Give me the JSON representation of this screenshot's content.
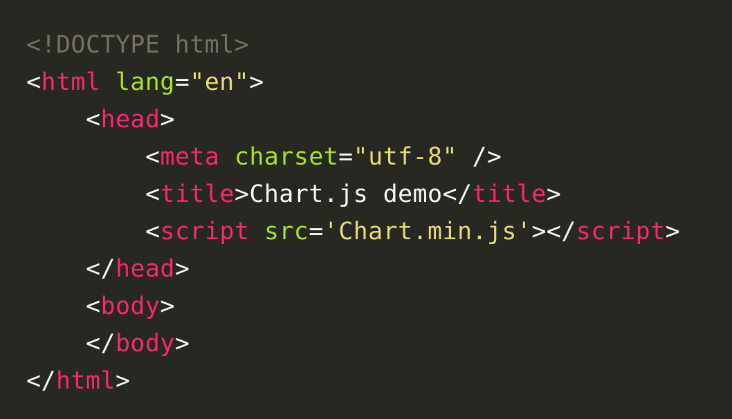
{
  "code": {
    "doctype": "<!DOCTYPE html>",
    "tags": {
      "html": "html",
      "head": "head",
      "meta": "meta",
      "title": "title",
      "script": "script",
      "body": "body"
    },
    "attrs": {
      "lang": "lang",
      "charset": "charset",
      "src": "src"
    },
    "values": {
      "lang": "\"en\"",
      "charset": "\"utf-8\"",
      "src": "'Chart.min.js'"
    },
    "title_text": "Chart.js demo"
  },
  "colors": {
    "background": "#272822",
    "tag": "#f92672",
    "attribute": "#a6e22e",
    "string": "#e6db74",
    "doctype": "#75715e",
    "text": "#f8f8f2"
  }
}
